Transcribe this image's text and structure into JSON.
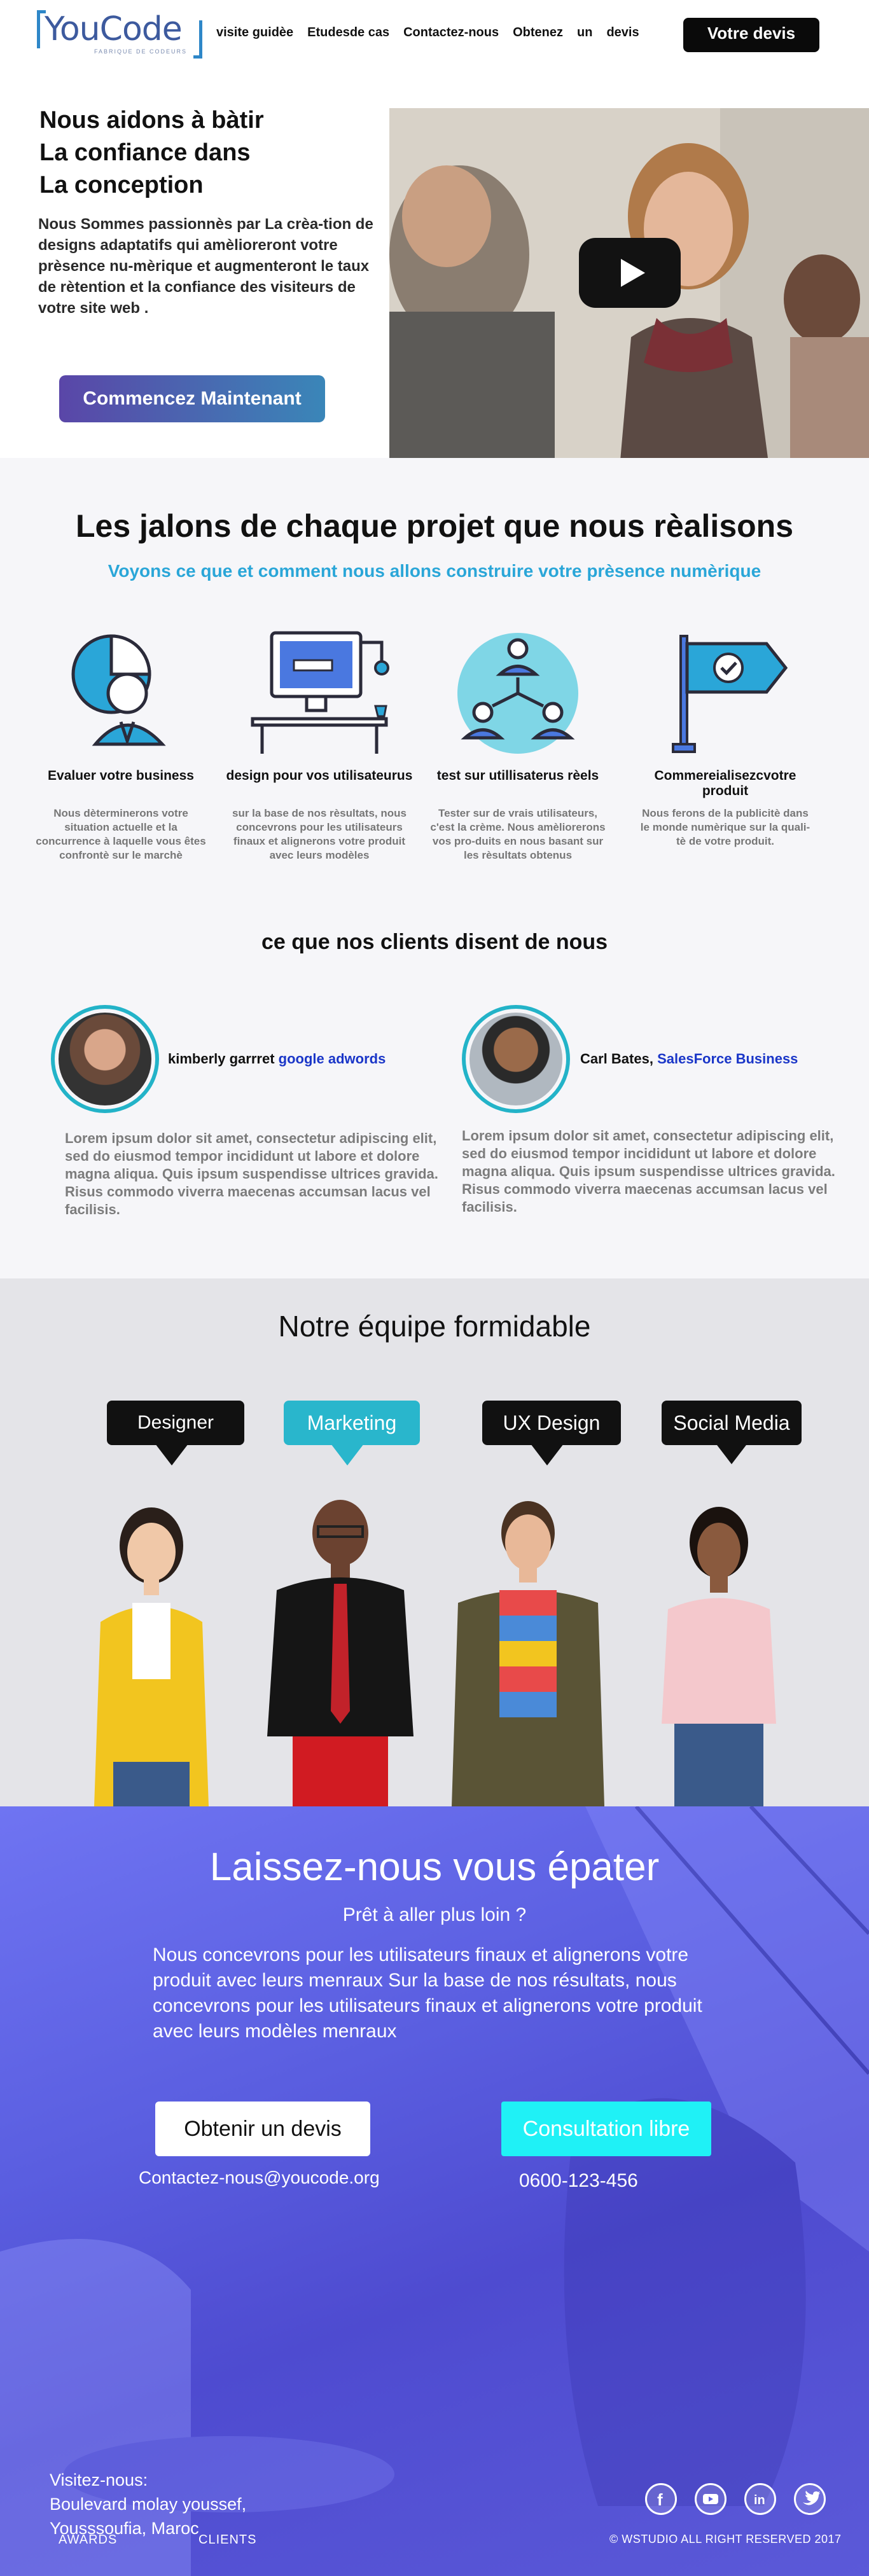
{
  "brand": {
    "name": "YouCode",
    "tagline": "FABRIQUE DE CODEURS"
  },
  "nav": {
    "links": [
      "visite guidèe",
      "Etudesde cas",
      "Contactez-nous",
      "Obtenez",
      "un",
      "devis"
    ],
    "cta": "Votre devis"
  },
  "hero": {
    "title_lines": [
      "Nous aidons à bàtir",
      "La confiance dans",
      "La conception"
    ],
    "paragraph": "Nous Sommes passionnès par La crèa-tion  de designs adaptatifs qui amèlioreront votre prèsence nu-mèrique et augmenteront le taux  de rètention et la confiance des visiteurs de votre site web .",
    "button": "Commencez Maintenant"
  },
  "milestones": {
    "title": "Les jalons de chaque projet que nous rèalisons",
    "subtitle": "Voyons ce que et comment nous allons construire votre prèsence numèrique",
    "features": [
      {
        "title": "Evaluer votre business",
        "desc": "Nous dèterminerons votre situation actuelle et la concurrence à laquelle vous êtes confrontè sur le marchè",
        "icon": "user-chart-icon"
      },
      {
        "title": "design pour vos utilisateurus",
        "desc": "sur la base de nos rèsultats, nous concevrons pour les utilisateurs finaux et alignerons votre produit avec leurs modèles",
        "icon": "desktop-design-icon"
      },
      {
        "title": "test sur utillisaterus rèels",
        "desc": "Tester sur de vrais utilisateurs, c'est la crème. Nous amèliorerons vos pro-duits en nous basant sur les rèsultats obtenus",
        "icon": "user-network-icon"
      },
      {
        "title": "Commereialisezcvotre produit",
        "desc": "Nous ferons de la publicitè dans le monde numèrique sur la quali-tè de votre produit.",
        "icon": "flag-check-icon"
      }
    ]
  },
  "testimonials": {
    "heading": "ce que nos clients disent de nous",
    "items": [
      {
        "name": "kimberly garrret",
        "company": "google adwords",
        "text": "Lorem ipsum dolor sit amet, consectetur adipiscing elit, sed do eiusmod tempor incididunt ut labore et dolore magna aliqua. Quis ipsum suspendisse ultrices gravida. Risus commodo viverra maecenas accumsan lacus vel facilisis."
      },
      {
        "name": "Carl Bates,",
        "company": "SalesForce Business",
        "text": "Lorem ipsum dolor sit amet, consectetur adipiscing elit, sed do eiusmod tempor incididunt ut labore et dolore magna aliqua. Quis ipsum suspendisse ultrices gravida. Risus commodo viverra maecenas accumsan lacus vel facilisis."
      }
    ]
  },
  "team": {
    "title": "Notre équipe formidable",
    "roles": [
      {
        "label": "Designer",
        "color": "#111111"
      },
      {
        "label": "Marketing",
        "color": "#29b6cc"
      },
      {
        "label": "UX Design",
        "color": "#111111"
      },
      {
        "label": "Social Media",
        "color": "#111111"
      }
    ]
  },
  "cta": {
    "title": "Laissez-nous vous épater",
    "subtitle": "Prêt à aller plus loin ?",
    "body": "Nous concevrons pour les utilisateurs finaux et alignerons votre produit avec leurs menraux Sur la base de nos résultats, nous concevrons pour les utilisateurs finaux et alignerons votre produit avec leurs modèles menraux",
    "quote_button": "Obtenir un devis",
    "consult_button": "Consultation libre",
    "email": "Contactez-nous@youcode.org",
    "phone": "0600-123-456"
  },
  "footer": {
    "visit_label": "Visitez-nous:",
    "address_line1": "Boulevard molay youssef,",
    "address_line2": "Yousssoufia, Maroc",
    "links": [
      "AWARDS",
      "CLIENTS"
    ],
    "copyright": "© WSTUDIO ALL RIGHT RESERVED 2017",
    "socials": [
      "facebook-icon",
      "youtube-icon",
      "linkedin-icon",
      "twitter-icon"
    ]
  }
}
